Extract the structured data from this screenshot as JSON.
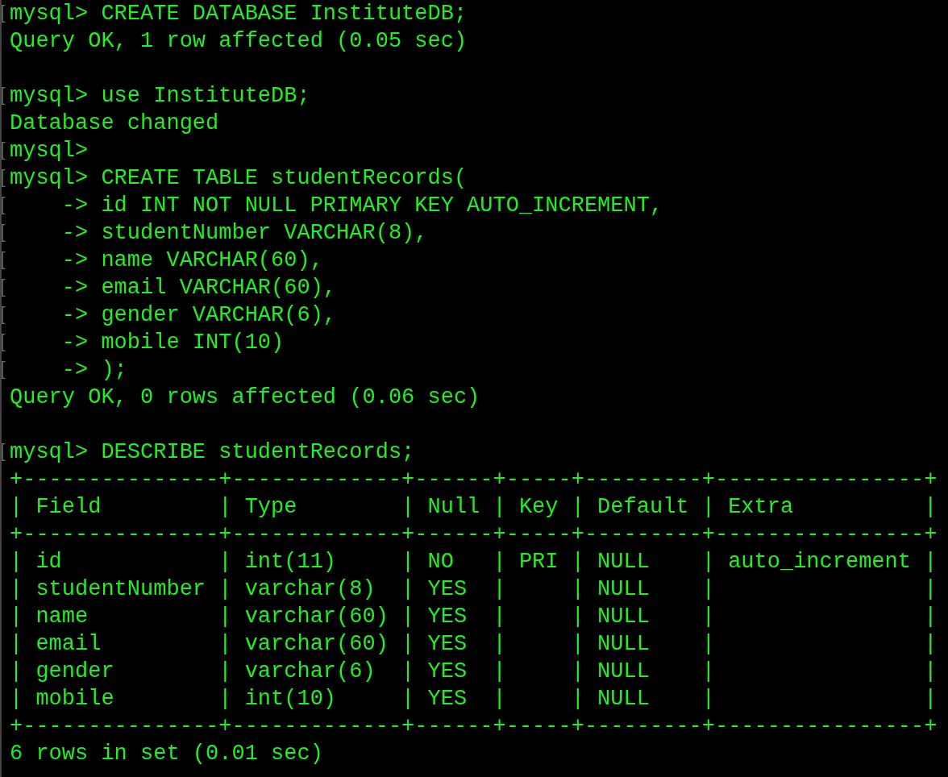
{
  "terminal": {
    "blocks": [
      {
        "lines": [
          {
            "text": "mysql> CREATE DATABASE InstituteDB;",
            "marked": true
          },
          {
            "text": "Query OK, 1 row affected (0.05 sec)",
            "marked": false
          }
        ]
      },
      {
        "lines": [
          {
            "text": "mysql> use InstituteDB;",
            "marked": true
          },
          {
            "text": "Database changed",
            "marked": false
          },
          {
            "text": "mysql>",
            "marked": true
          },
          {
            "text": "mysql> CREATE TABLE studentRecords(",
            "marked": true
          },
          {
            "text": "    -> id INT NOT NULL PRIMARY KEY AUTO_INCREMENT,",
            "marked": true
          },
          {
            "text": "    -> studentNumber VARCHAR(8),",
            "marked": true
          },
          {
            "text": "    -> name VARCHAR(60),",
            "marked": true
          },
          {
            "text": "    -> email VARCHAR(60),",
            "marked": true
          },
          {
            "text": "    -> gender VARCHAR(6),",
            "marked": true
          },
          {
            "text": "    -> mobile INT(10)",
            "marked": true
          },
          {
            "text": "    -> );",
            "marked": true
          },
          {
            "text": "Query OK, 0 rows affected (0.06 sec)",
            "marked": false
          }
        ]
      },
      {
        "lines": [
          {
            "text": "mysql> DESCRIBE studentRecords;",
            "marked": true
          },
          {
            "text": "+---------------+-------------+------+-----+---------+----------------+",
            "marked": false
          },
          {
            "text": "| Field         | Type        | Null | Key | Default | Extra          |",
            "marked": false
          },
          {
            "text": "+---------------+-------------+------+-----+---------+----------------+",
            "marked": false
          },
          {
            "text": "| id            | int(11)     | NO   | PRI | NULL    | auto_increment |",
            "marked": false
          },
          {
            "text": "| studentNumber | varchar(8)  | YES  |     | NULL    |                |",
            "marked": false
          },
          {
            "text": "| name          | varchar(60) | YES  |     | NULL    |                |",
            "marked": false
          },
          {
            "text": "| email         | varchar(60) | YES  |     | NULL    |                |",
            "marked": false
          },
          {
            "text": "| gender        | varchar(6)  | YES  |     | NULL    |                |",
            "marked": false
          },
          {
            "text": "| mobile        | int(10)     | YES  |     | NULL    |                |",
            "marked": false
          },
          {
            "text": "+---------------+-------------+------+-----+---------+----------------+",
            "marked": false
          },
          {
            "text": "6 rows in set (0.01 sec)",
            "marked": false
          }
        ]
      }
    ]
  }
}
